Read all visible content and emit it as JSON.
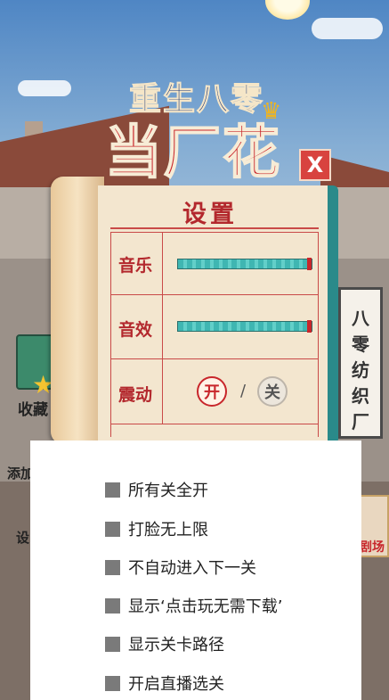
{
  "game": {
    "title_top": "重生八零",
    "title_main": "当厂花",
    "side_left_label1": "收藏",
    "side_left_label2": "添加",
    "side_left_label3": "设",
    "side_right_label": "剧场",
    "plaque_chars": [
      "八",
      "零",
      "纺",
      "织",
      "厂"
    ]
  },
  "settings": {
    "title": "设置",
    "close_label": "X",
    "music_label": "音乐",
    "music_level": 1.0,
    "sfx_label": "音效",
    "sfx_level": 1.0,
    "vibrate_label": "震动",
    "vibrate_on_label": "开",
    "vibrate_separator": "/",
    "vibrate_off_label": "关"
  },
  "menu": {
    "items": [
      "所有关全开",
      "打脸无上限",
      "不自动进入下一关",
      "显示‘点击玩无需下载’",
      "显示关卡路径",
      "开启直播选关"
    ]
  }
}
